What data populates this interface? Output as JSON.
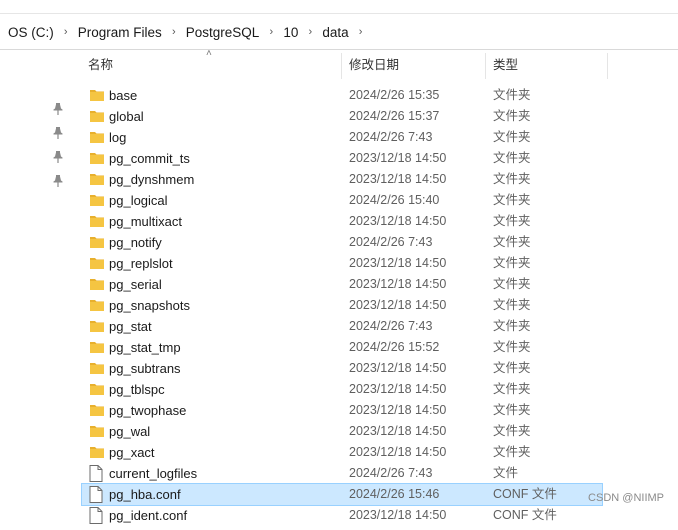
{
  "breadcrumb": [
    "OS (C:)",
    "Program Files",
    "PostgreSQL",
    "10",
    "data"
  ],
  "columns": {
    "name": "名称",
    "date": "修改日期",
    "type": "类型"
  },
  "files": [
    {
      "name": "base",
      "date": "2024/2/26 15:35",
      "type": "文件夹",
      "icon": "folder"
    },
    {
      "name": "global",
      "date": "2024/2/26 15:37",
      "type": "文件夹",
      "icon": "folder"
    },
    {
      "name": "log",
      "date": "2024/2/26 7:43",
      "type": "文件夹",
      "icon": "folder"
    },
    {
      "name": "pg_commit_ts",
      "date": "2023/12/18 14:50",
      "type": "文件夹",
      "icon": "folder"
    },
    {
      "name": "pg_dynshmem",
      "date": "2023/12/18 14:50",
      "type": "文件夹",
      "icon": "folder"
    },
    {
      "name": "pg_logical",
      "date": "2024/2/26 15:40",
      "type": "文件夹",
      "icon": "folder"
    },
    {
      "name": "pg_multixact",
      "date": "2023/12/18 14:50",
      "type": "文件夹",
      "icon": "folder"
    },
    {
      "name": "pg_notify",
      "date": "2024/2/26 7:43",
      "type": "文件夹",
      "icon": "folder"
    },
    {
      "name": "pg_replslot",
      "date": "2023/12/18 14:50",
      "type": "文件夹",
      "icon": "folder"
    },
    {
      "name": "pg_serial",
      "date": "2023/12/18 14:50",
      "type": "文件夹",
      "icon": "folder"
    },
    {
      "name": "pg_snapshots",
      "date": "2023/12/18 14:50",
      "type": "文件夹",
      "icon": "folder"
    },
    {
      "name": "pg_stat",
      "date": "2024/2/26 7:43",
      "type": "文件夹",
      "icon": "folder"
    },
    {
      "name": "pg_stat_tmp",
      "date": "2024/2/26 15:52",
      "type": "文件夹",
      "icon": "folder"
    },
    {
      "name": "pg_subtrans",
      "date": "2023/12/18 14:50",
      "type": "文件夹",
      "icon": "folder"
    },
    {
      "name": "pg_tblspc",
      "date": "2023/12/18 14:50",
      "type": "文件夹",
      "icon": "folder"
    },
    {
      "name": "pg_twophase",
      "date": "2023/12/18 14:50",
      "type": "文件夹",
      "icon": "folder"
    },
    {
      "name": "pg_wal",
      "date": "2023/12/18 14:50",
      "type": "文件夹",
      "icon": "folder"
    },
    {
      "name": "pg_xact",
      "date": "2023/12/18 14:50",
      "type": "文件夹",
      "icon": "folder"
    },
    {
      "name": "current_logfiles",
      "date": "2024/2/26 7:43",
      "type": "文件",
      "icon": "file"
    },
    {
      "name": "pg_hba.conf",
      "date": "2024/2/26 15:46",
      "type": "CONF 文件",
      "icon": "file",
      "selected": true
    },
    {
      "name": "pg_ident.conf",
      "date": "2023/12/18 14:50",
      "type": "CONF 文件",
      "icon": "file"
    }
  ],
  "colors": {
    "folder": "#f5c542",
    "selection": "#cce8ff"
  },
  "watermark": "CSDN @NIIMP"
}
